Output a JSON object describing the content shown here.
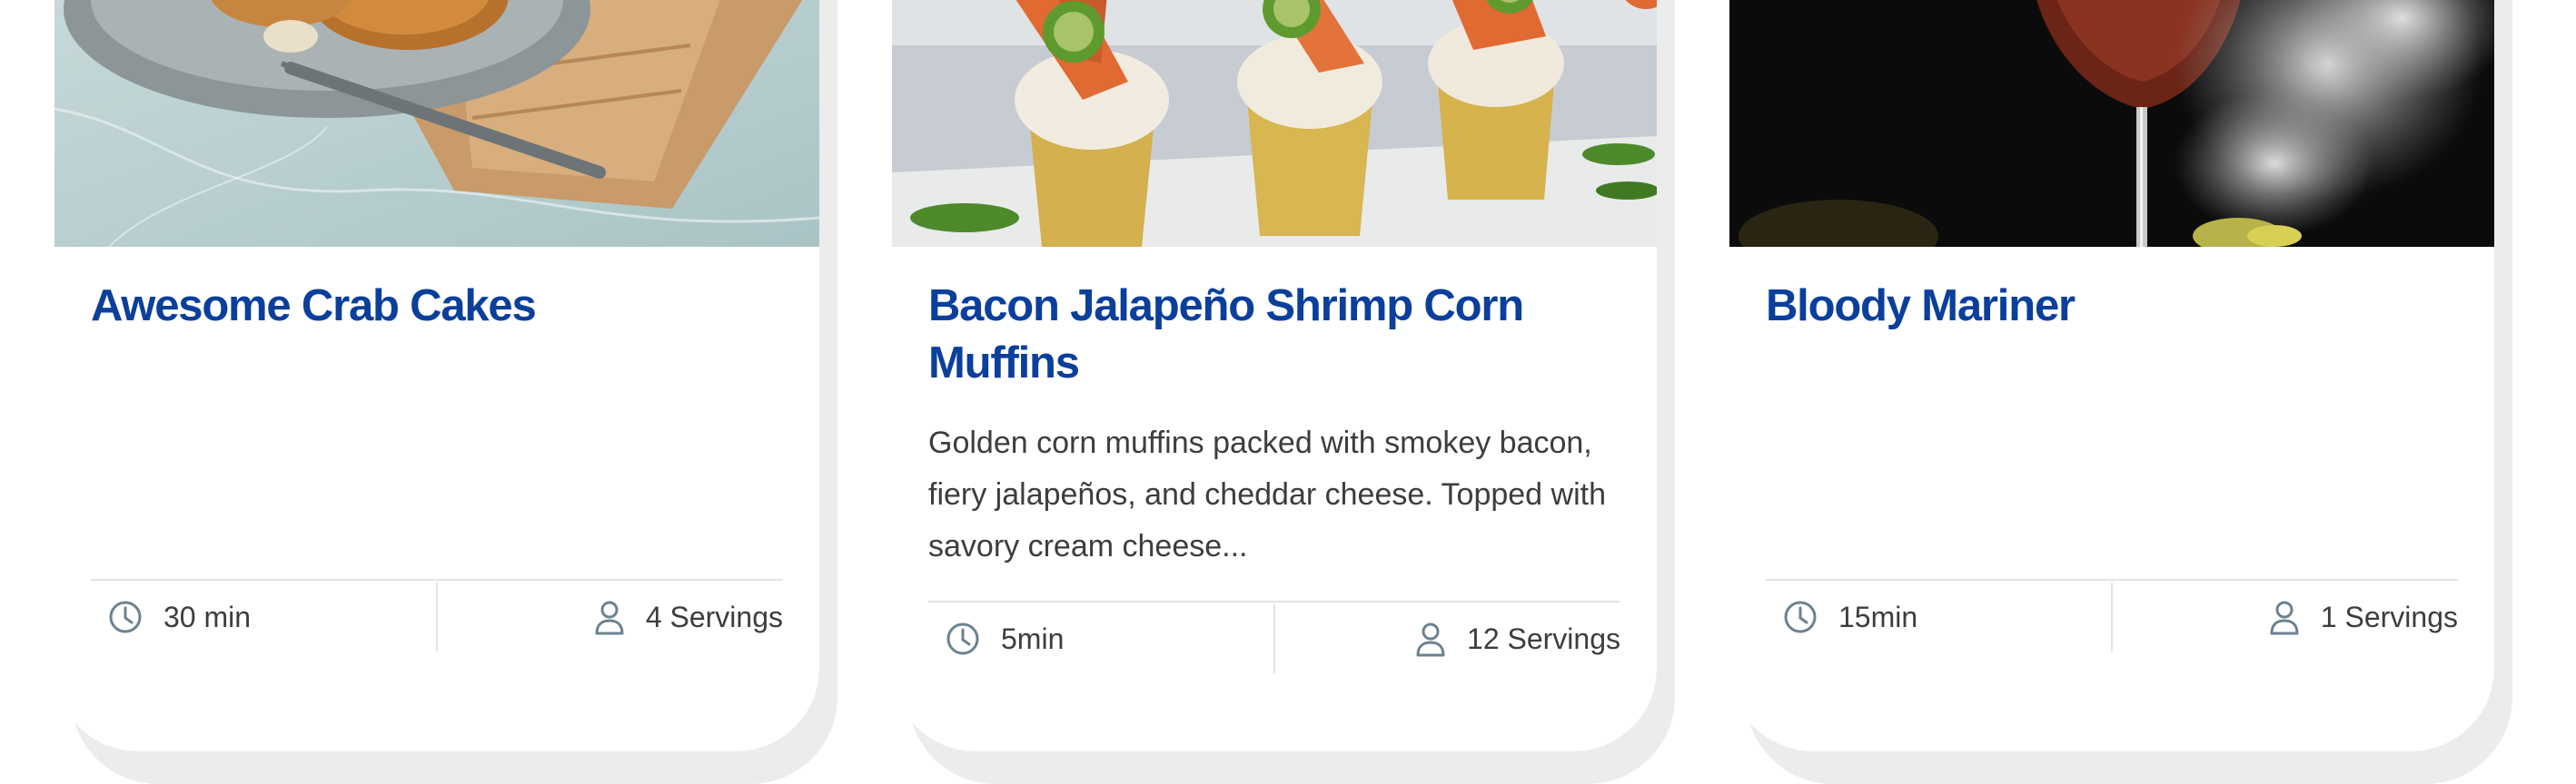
{
  "recipes": [
    {
      "title": "Awesome Crab Cakes",
      "description": "",
      "time": "30 min",
      "servings": "4 Servings",
      "time_icon": "clock-icon",
      "servings_icon": "person-icon"
    },
    {
      "title": "Bacon Jalapeño Shrimp Corn Muffins",
      "description": "Golden corn muffins packed with smokey bacon, fiery jalapeños, and cheddar cheese. Topped with savory cream cheese...",
      "time": "5min",
      "servings": "12 Servings",
      "time_icon": "clock-icon",
      "servings_icon": "person-icon"
    },
    {
      "title": "Bloody Mariner",
      "description": "",
      "time": "15min",
      "servings": "1 Servings",
      "time_icon": "clock-icon",
      "servings_icon": "person-icon"
    }
  ],
  "colors": {
    "title": "#0b3f9c",
    "text": "#3b3d40",
    "icon": "#6b8290",
    "divider": "#e2e4e7",
    "card_shadow": "#ececec"
  }
}
